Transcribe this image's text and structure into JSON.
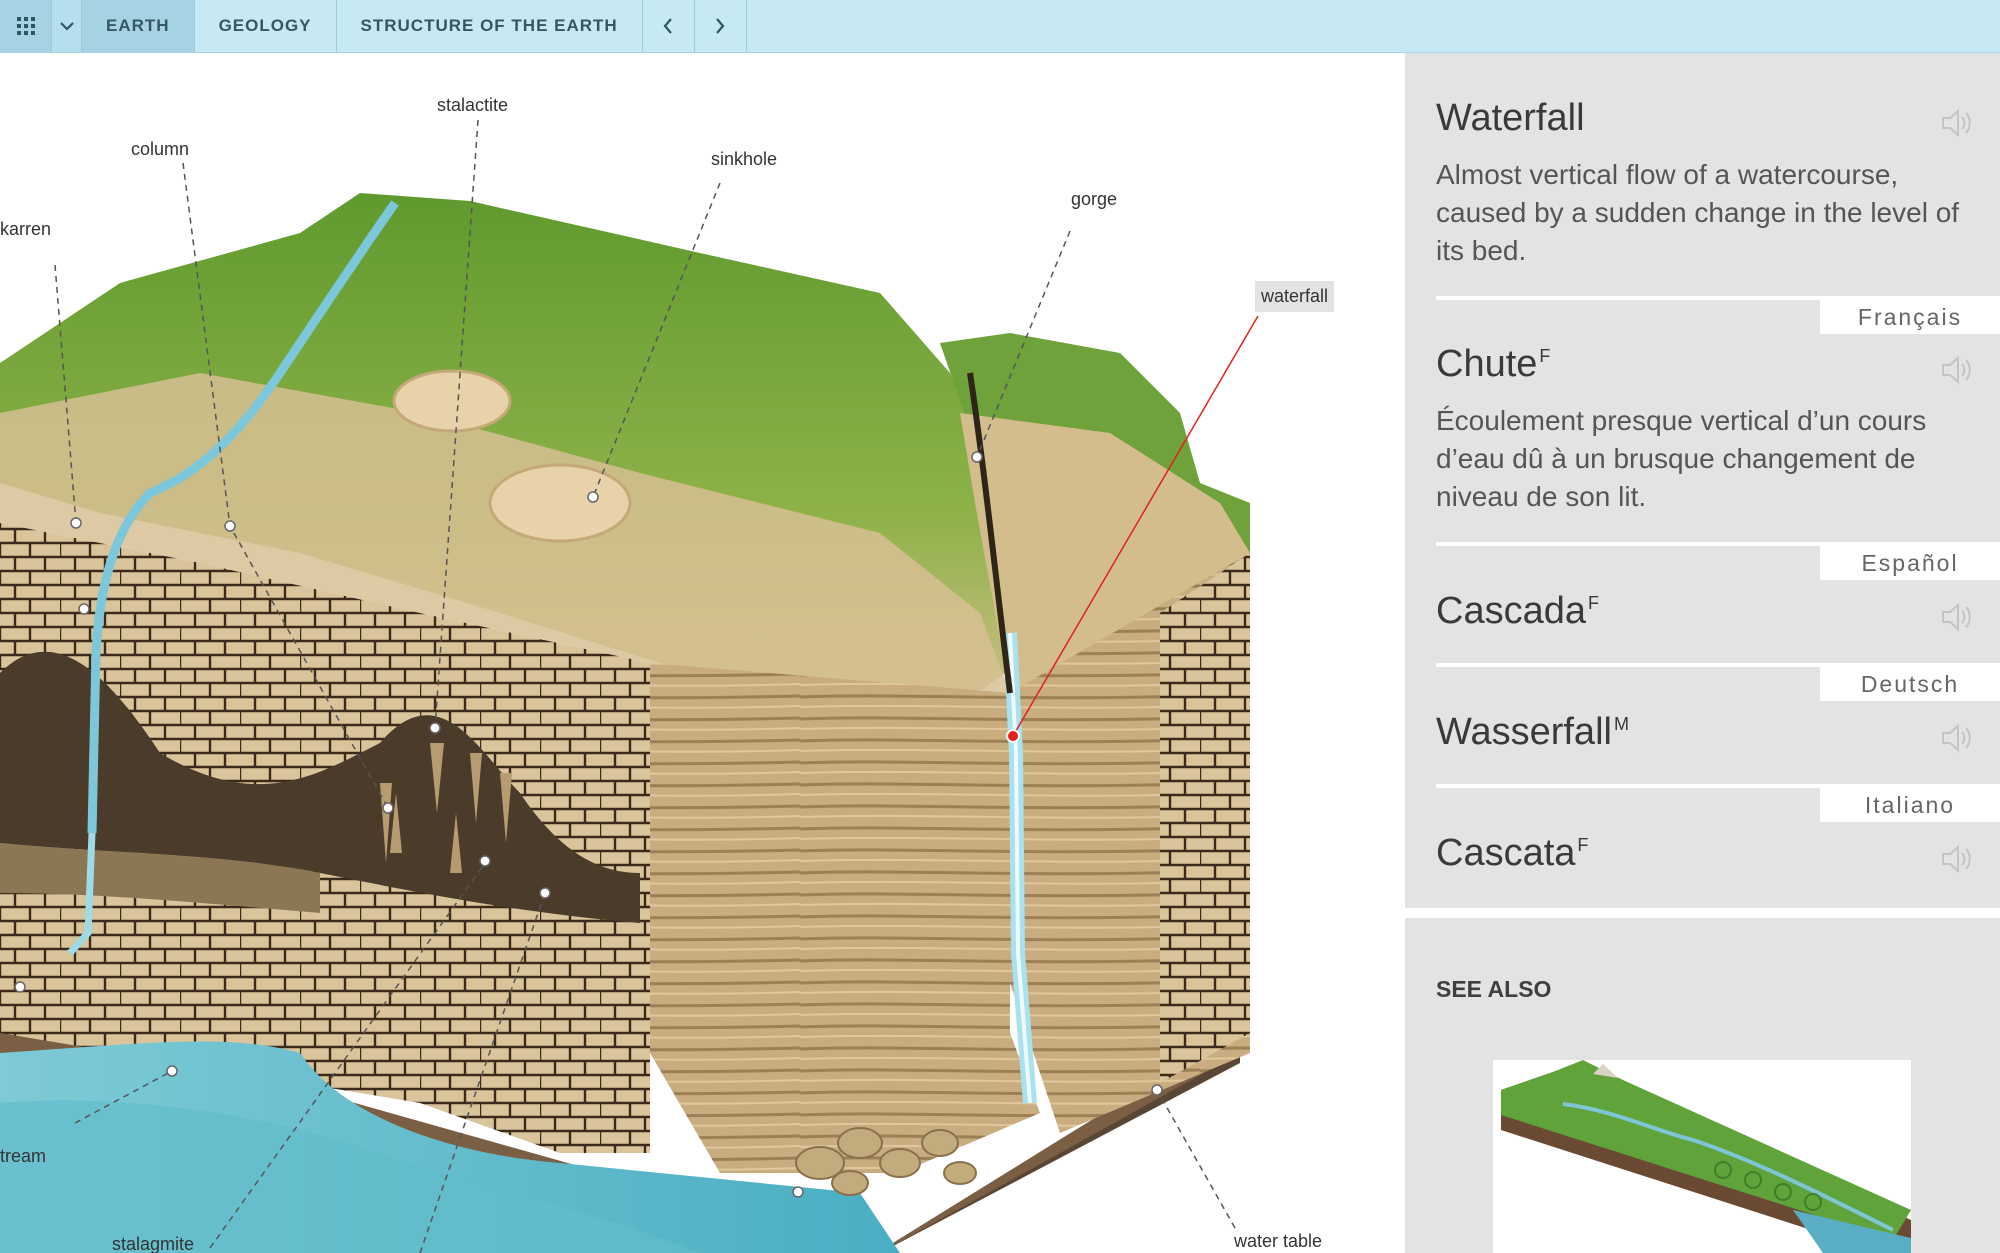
{
  "nav": {
    "grid_icon": "grid-icon",
    "dropdown_icon": "chevron-down-icon",
    "breadcrumbs": [
      "EARTH",
      "GEOLOGY",
      "STRUCTURE OF THE EARTH"
    ],
    "prev_icon": "chevron-left-icon",
    "next_icon": "chevron-right-icon"
  },
  "illustration": {
    "labels": {
      "stalactite": "stalactite",
      "column": "column",
      "sinkhole": "sinkhole",
      "gorge": "gorge",
      "karren": "karren",
      "waterfall": "waterfall",
      "stream": "tream",
      "stalagmite": "stalagmite",
      "water_table": "water table"
    },
    "selected": "waterfall"
  },
  "panel": {
    "title": "Waterfall",
    "definition": "Almost vertical flow of a watercourse, caused by a sudden change in the level of its bed.",
    "translations": [
      {
        "language": "Français",
        "term": "Chute",
        "gender": "F",
        "definition": "Écoulement presque vertical d’un cours d’eau dû à un brusque changement de niveau de son lit."
      },
      {
        "language": "Español",
        "term": "Cascada",
        "gender": "F"
      },
      {
        "language": "Deutsch",
        "term": "Wasserfall",
        "gender": "M"
      },
      {
        "language": "Italiano",
        "term": "Cascata",
        "gender": "F"
      }
    ],
    "speaker_icon": "speaker-icon"
  },
  "see_also": {
    "title": "SEE ALSO"
  },
  "colors": {
    "topbar": "#c6e9f4",
    "panel": "#e3e3e3",
    "marker": "#e02020"
  }
}
